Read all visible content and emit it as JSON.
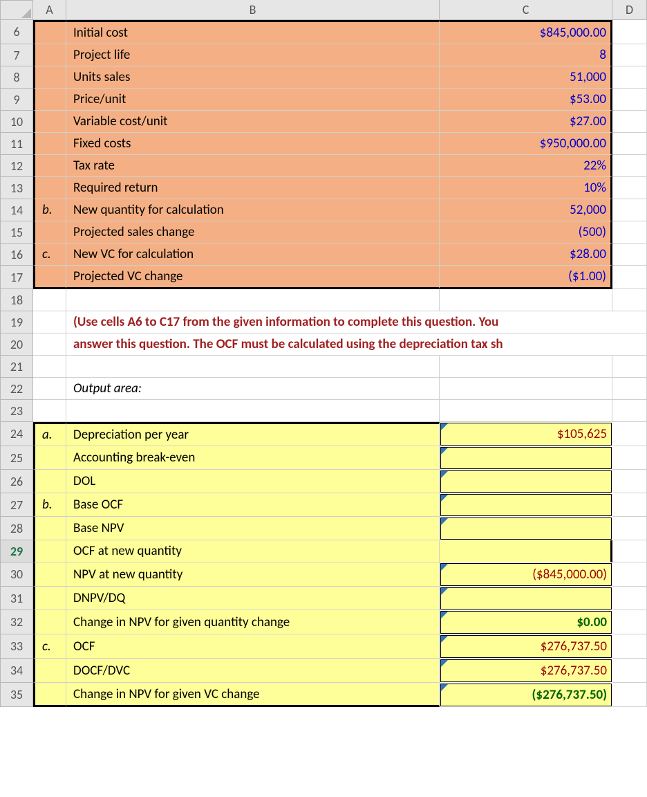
{
  "columns": [
    "A",
    "B",
    "C",
    "D"
  ],
  "rows": {
    "6": {
      "n": "6",
      "a": "",
      "b": "Initial cost",
      "c": "$845,000.00"
    },
    "7": {
      "n": "7",
      "a": "",
      "b": "Project life",
      "c": "8"
    },
    "8": {
      "n": "8",
      "a": "",
      "b": "Units sales",
      "c": "51,000"
    },
    "9": {
      "n": "9",
      "a": "",
      "b": "Price/unit",
      "c": "$53.00"
    },
    "10": {
      "n": "10",
      "a": "",
      "b": "Variable cost/unit",
      "c": "$27.00"
    },
    "11": {
      "n": "11",
      "a": "",
      "b": "Fixed costs",
      "c": "$950,000.00"
    },
    "12": {
      "n": "12",
      "a": "",
      "b": "Tax rate",
      "c": "22%"
    },
    "13": {
      "n": "13",
      "a": "",
      "b": "Required return",
      "c": "10%"
    },
    "14": {
      "n": "14",
      "a": "b.",
      "b": "New quantity for calculation",
      "c": "52,000"
    },
    "15": {
      "n": "15",
      "a": "",
      "b": "Projected sales change",
      "c": "(500)"
    },
    "16": {
      "n": "16",
      "a": "c.",
      "b": "New VC for calculation",
      "c": "$28.00"
    },
    "17": {
      "n": "17",
      "a": "",
      "b": "Projected VC change",
      "c": "($1.00)"
    },
    "18": {
      "n": "18"
    },
    "19": {
      "n": "19",
      "b": "(Use cells A6 to C17 from the given information to complete this question. You"
    },
    "20": {
      "n": "20",
      "b": "answer this question. The OCF must be calculated using the depreciation tax sh"
    },
    "21": {
      "n": "21"
    },
    "22": {
      "n": "22",
      "b": "Output area:"
    },
    "23": {
      "n": "23"
    },
    "24": {
      "n": "24",
      "a": "a.",
      "b": "Depreciation per year",
      "c": "$105,625"
    },
    "25": {
      "n": "25",
      "a": "",
      "b": "Accounting break-even",
      "c": ""
    },
    "26": {
      "n": "26",
      "a": "",
      "b": "DOL",
      "c": ""
    },
    "27": {
      "n": "27",
      "a": "b.",
      "b": "Base OCF",
      "c": ""
    },
    "28": {
      "n": "28",
      "a": "",
      "b": "Base NPV",
      "c": ""
    },
    "29": {
      "n": "29",
      "a": "",
      "b": "OCF at new quantity",
      "c": ""
    },
    "30": {
      "n": "30",
      "a": "",
      "b": "NPV at new quantity",
      "c": "($845,000.00)"
    },
    "31": {
      "n": "31",
      "a": "",
      "b": "DNPV/DQ",
      "c": ""
    },
    "32": {
      "n": "32",
      "a": "",
      "b": "Change in NPV for given quantity change",
      "c": "$0.00"
    },
    "33": {
      "n": "33",
      "a": "c.",
      "b": "OCF",
      "c": "$276,737.50"
    },
    "34": {
      "n": "34",
      "a": "",
      "b": "DOCF/DVC",
      "c": "$276,737.50"
    },
    "35": {
      "n": "35",
      "a": "",
      "b": "Change in NPV for given VC change",
      "c": "($276,737.50)"
    }
  }
}
